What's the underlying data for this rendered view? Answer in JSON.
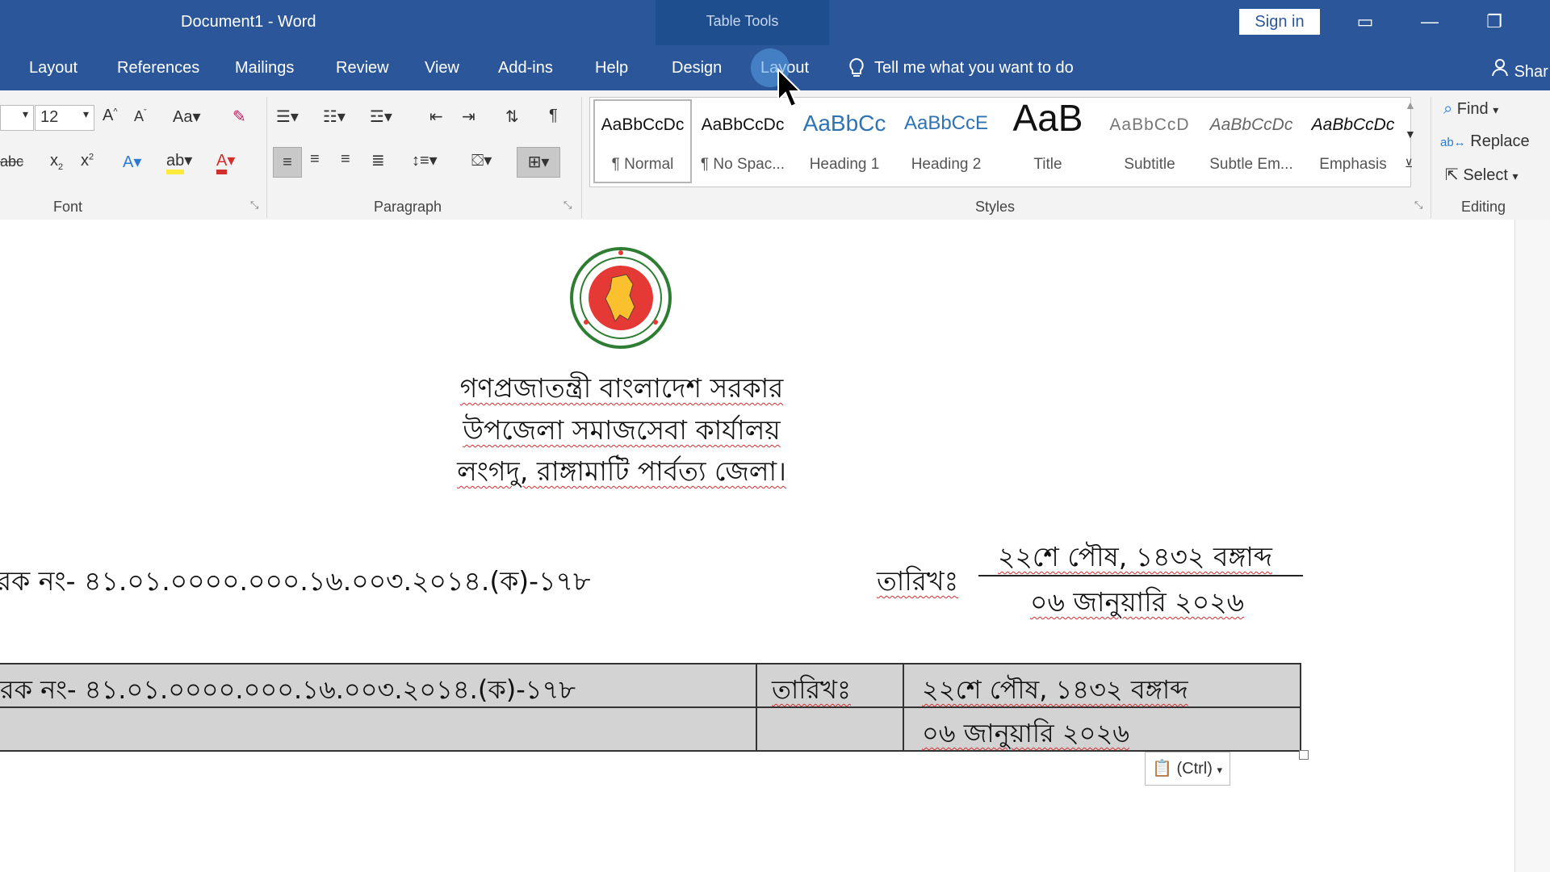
{
  "window": {
    "title": "Document1  -  Word",
    "contextual_group": "Table Tools",
    "sign_in": "Sign in",
    "share": "Shar"
  },
  "tabs": [
    "Layout",
    "References",
    "Mailings",
    "Review",
    "View",
    "Add-ins",
    "Help",
    "Design",
    "Layout"
  ],
  "tell_me": "Tell me what you want to do",
  "ribbon": {
    "font_size": "12",
    "groups": {
      "font": "Font",
      "paragraph": "Paragraph",
      "styles": "Styles",
      "editing": "Editing"
    },
    "styles": [
      {
        "sample": "AaBbCcDc",
        "name": "¶ Normal"
      },
      {
        "sample": "AaBbCcDc",
        "name": "¶ No Spac..."
      },
      {
        "sample": "AaBbCc",
        "name": "Heading 1"
      },
      {
        "sample": "AaBbCcE",
        "name": "Heading 2"
      },
      {
        "sample": "AaB",
        "name": "Title"
      },
      {
        "sample": "AaBbCcD",
        "name": "Subtitle"
      },
      {
        "sample": "AaBbCcDc",
        "name": "Subtle Em..."
      },
      {
        "sample": "AaBbCcDc",
        "name": "Emphasis"
      }
    ],
    "editing": {
      "find": "Find",
      "replace": "Replace",
      "select": "Select"
    }
  },
  "document": {
    "header_lines": [
      "গণপ্রজাতন্ত্রী বাংলাদেশ সরকার",
      "উপজেলা সমাজসেবা কার্যালয়",
      "লংগদু, রাঙ্গামাটি পার্বত্য জেলা।"
    ],
    "memo_number": "রক নং- ৪১.০১.০০০০.০০০.১৬.০০৩.২০১৪.(ক)-১৭৮",
    "date_label": "তারিখঃ",
    "date_bangla": "২২শে পৌষ, ১৪৩২ বঙ্গাব্দ",
    "date_english": "০৬ জানুয়ারি ২০২৬",
    "table": {
      "memo_number": "রক নং- ৪১.০১.০০০০.০০০.১৬.০০৩.২০১৪.(ক)-১৭৮",
      "date_label": "তারিখঃ",
      "date_bangla": "২২শে পৌষ, ১৪৩২ বঙ্গাব্দ",
      "date_english": "০৬ জানুয়ারি ২০২৬"
    },
    "paste_options": "(Ctrl)",
    "seal_text": "গণপ্রজাতন্ত্রী বাংলাদেশ সরকার"
  }
}
